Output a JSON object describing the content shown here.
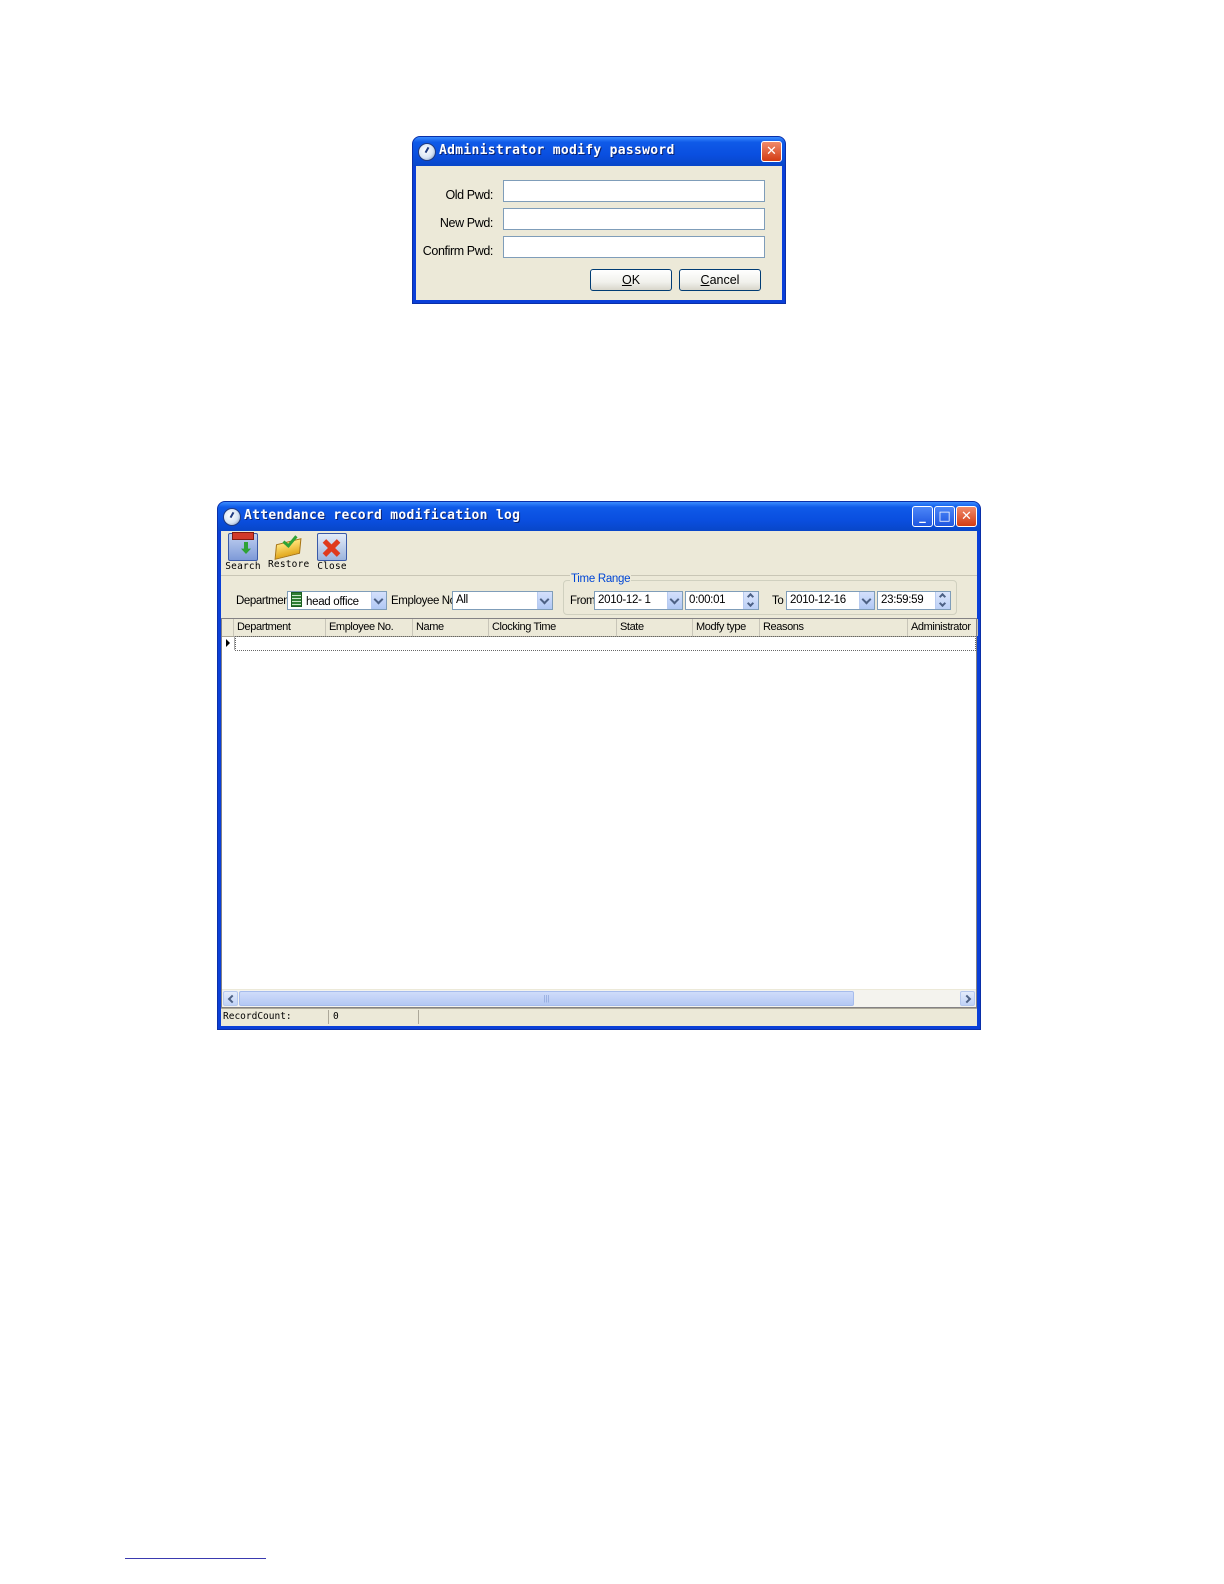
{
  "password_dialog": {
    "title": "Administrator modify password",
    "old_pwd_label": "Old Pwd:",
    "new_pwd_label": "New Pwd:",
    "confirm_pwd_label": "Confirm Pwd:",
    "old_pwd_value": "",
    "new_pwd_value": "",
    "confirm_pwd_value": "",
    "ok_button": "OK",
    "cancel_button": "Cancel"
  },
  "log_window": {
    "title": "Attendance record modification log",
    "toolbar": [
      {
        "label": "Search",
        "icon": "search-icon"
      },
      {
        "label": "Restore",
        "icon": "restore-icon"
      },
      {
        "label": "Close",
        "icon": "close-doc-icon"
      }
    ],
    "filters": {
      "department_label": "Department",
      "department_value": "head office",
      "employee_no_label": "Employee No.",
      "employee_no_value": "All",
      "time_range_label": "Time Range",
      "from_label": "From",
      "from_date": "2010-12- 1",
      "from_time": "0:00:01",
      "to_label": "To",
      "to_date": "2010-12-16",
      "to_time": "23:59:59"
    },
    "columns": [
      "Department",
      "Employee No.",
      "Name",
      "Clocking Time",
      "State",
      "Modfy type",
      "Reasons",
      "Administrator"
    ],
    "rows": [],
    "status": {
      "record_count_label": "RecordCount:",
      "record_count_value": "0"
    }
  }
}
